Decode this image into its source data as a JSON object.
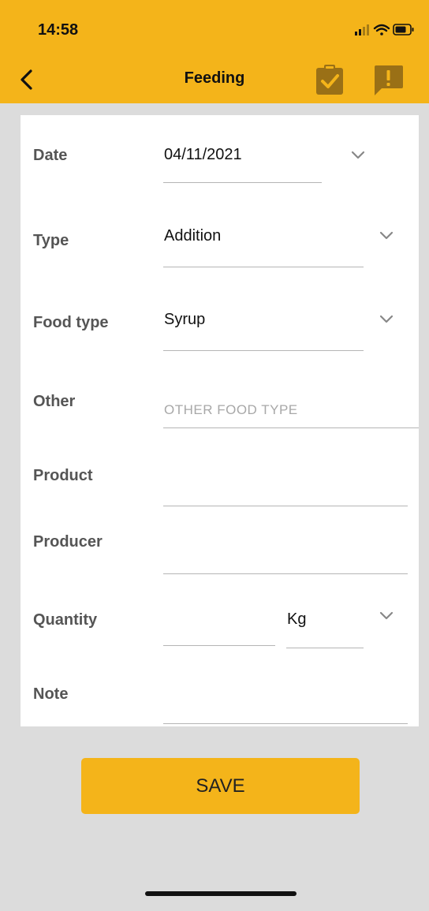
{
  "status_bar": {
    "time": "14:58"
  },
  "nav": {
    "title": "Feeding",
    "back_icon": "chevron-left-icon",
    "checklist_icon": "clipboard-check-icon",
    "alert_icon": "comment-alert-icon"
  },
  "form": {
    "date": {
      "label": "Date",
      "value": "04/11/2021"
    },
    "type": {
      "label": "Type",
      "value": "Addition"
    },
    "food_type": {
      "label": "Food type",
      "value": "Syrup"
    },
    "other": {
      "label": "Other",
      "placeholder": "OTHER FOOD TYPE"
    },
    "product": {
      "label": "Product",
      "value": ""
    },
    "producer": {
      "label": "Producer",
      "value": ""
    },
    "quantity": {
      "label": "Quantity",
      "value": "",
      "unit": "Kg"
    },
    "note": {
      "label": "Note",
      "value": ""
    }
  },
  "save_button": {
    "label": "SAVE"
  },
  "colors": {
    "accent": "#f4b41a",
    "background": "#dcdcdc"
  }
}
